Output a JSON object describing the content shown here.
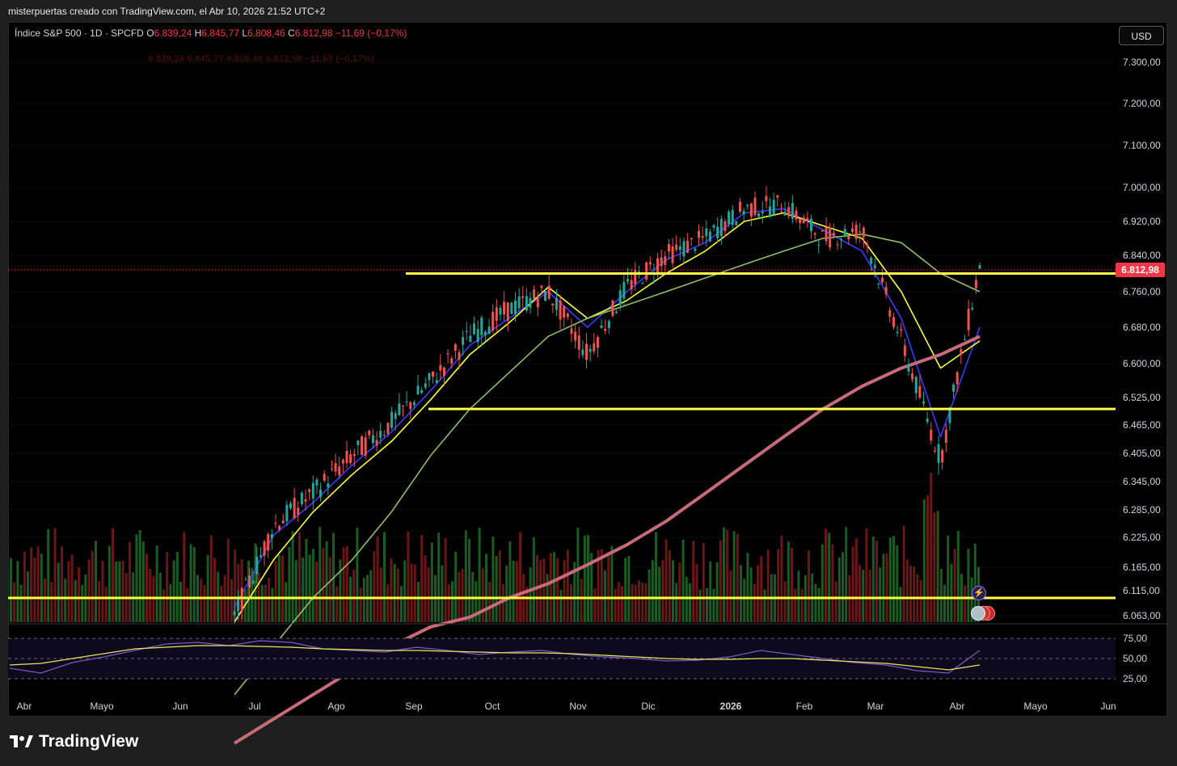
{
  "header": {
    "attribution": "misterpuertas creado con TradingView.com, el Abr 10, 2026 21:52 UTC+2"
  },
  "legend": {
    "symbol": "Índice S&P 500 · 1D · SPCFD",
    "o_label": "O",
    "o_value": "6.839,24",
    "h_label": "H",
    "h_value": "6.845,77",
    "l_label": "L",
    "l_value": "6.808,46",
    "c_label": "C",
    "c_value": "6.812,98",
    "change": "−11,69 (−0,17%)",
    "ghost_row": "6.839,24   6.845,77   6.808,46   6.812,98   −11,69 (−0,17%)"
  },
  "currency_button": "USD",
  "last_price_tag": "6.812,98",
  "brand": {
    "name": "TradingView"
  },
  "icons": {
    "event_flash": "flash-icon",
    "event_flags": "us-flag-icon"
  },
  "colors": {
    "up": "#26a69a",
    "down": "#ef5350",
    "ema_fast": "#3b3bff",
    "ema_yellow": "#ffff33",
    "sma_green": "#8fbf6a",
    "sma_red": "#c76a7a",
    "level_line": "#ffff44",
    "rsi": "#7e57c2",
    "rsi_ma": "#e6e65a"
  },
  "chart_data": {
    "type": "line",
    "title": "Índice S&P 500 · 1D · SPCFD",
    "y_axis": {
      "min": 6040,
      "max": 7360,
      "ticks": [
        7300,
        7200,
        7100,
        7000,
        6920,
        6840,
        6760,
        6680,
        6600,
        6525,
        6465,
        6405,
        6345,
        6285,
        6225,
        6165,
        6115,
        6063
      ],
      "tick_labels": [
        "7.300,00",
        "7.200,00",
        "7.100,00",
        "7.000,00",
        "6.920,00",
        "6.840,00",
        "6.760,00",
        "6.680,00",
        "6.600,00",
        "6.525,00",
        "6.465,00",
        "6.405,00",
        "6.345,00",
        "6.285,00",
        "6.225,00",
        "6.165,00",
        "6.115,00",
        "6.063,00"
      ]
    },
    "x_axis": {
      "labels": [
        "Abr",
        "Mayo",
        "Jun",
        "Jul",
        "Ago",
        "Sep",
        "Oct",
        "Nov",
        "Dic",
        "2026",
        "Feb",
        "Mar",
        "Abr",
        "Mayo",
        "Jun"
      ]
    },
    "horizontal_levels": [
      {
        "value": 6800,
        "from": "Sep"
      },
      {
        "value": 6500,
        "from": "Sep"
      },
      {
        "value": 6100,
        "from": "Abr"
      }
    ],
    "series": [
      {
        "name": "",
        "x": [
          "Jul",
          "Jul",
          "Ago",
          "Ago",
          "Sep",
          "Sep",
          "Oct",
          "Oct",
          "Nov",
          "Nov",
          "Dic",
          "Dic",
          "2026",
          "2026",
          "Feb",
          "Feb",
          "Mar",
          "Mar",
          "Abr",
          "Abr"
        ],
        "values": [
          6060,
          6250,
          6320,
          6400,
          6470,
          6560,
          6660,
          6720,
          6760,
          6620,
          6770,
          6840,
          6880,
          6950,
          6960,
          6880,
          6900,
          6650,
          6390,
          6820
        ]
      }
    ],
    "moving_averages": [
      {
        "color": "#3b3bff",
        "values": [
          6080,
          6230,
          6300,
          6380,
          6450,
          6540,
          6640,
          6700,
          6760,
          6680,
          6760,
          6830,
          6870,
          6940,
          6950,
          6900,
          6850,
          6700,
          6440,
          6680
        ]
      },
      {
        "color": "#ffff33",
        "values": [
          6050,
          6180,
          6280,
          6360,
          6430,
          6520,
          6620,
          6690,
          6770,
          6700,
          6740,
          6800,
          6850,
          6920,
          6940,
          6910,
          6880,
          6760,
          6590,
          6650
        ]
      },
      {
        "color": "#8fbf6a",
        "values": [
          5900,
          6000,
          6100,
          6180,
          6280,
          6400,
          6500,
          6580,
          6660,
          6700,
          6730,
          6760,
          6790,
          6820,
          6850,
          6880,
          6890,
          6870,
          6800,
          6760
        ]
      },
      {
        "color": "#c76a7a",
        "values": [
          5800,
          5850,
          5900,
          5950,
          6000,
          6040,
          6060,
          6100,
          6130,
          6170,
          6210,
          6260,
          6320,
          6380,
          6440,
          6500,
          6550,
          6590,
          6620,
          6660
        ]
      }
    ],
    "rsi": {
      "y_ticks": [
        75,
        50,
        25
      ],
      "tick_labels": [
        "75,00",
        "50,00",
        "25,00"
      ],
      "values": [
        38,
        32,
        45,
        52,
        60,
        68,
        70,
        66,
        72,
        70,
        62,
        60,
        58,
        64,
        60,
        55,
        58,
        60,
        55,
        52,
        50,
        47,
        48,
        52,
        60,
        55,
        50,
        45,
        42,
        35,
        32,
        60
      ],
      "ma_values": [
        42,
        44,
        50,
        56,
        62,
        64,
        66,
        66,
        65,
        64,
        62,
        61,
        60,
        60,
        59,
        58,
        57,
        57,
        56,
        54,
        52,
        50,
        49,
        49,
        50,
        50,
        48,
        46,
        44,
        40,
        36,
        42
      ]
    }
  }
}
